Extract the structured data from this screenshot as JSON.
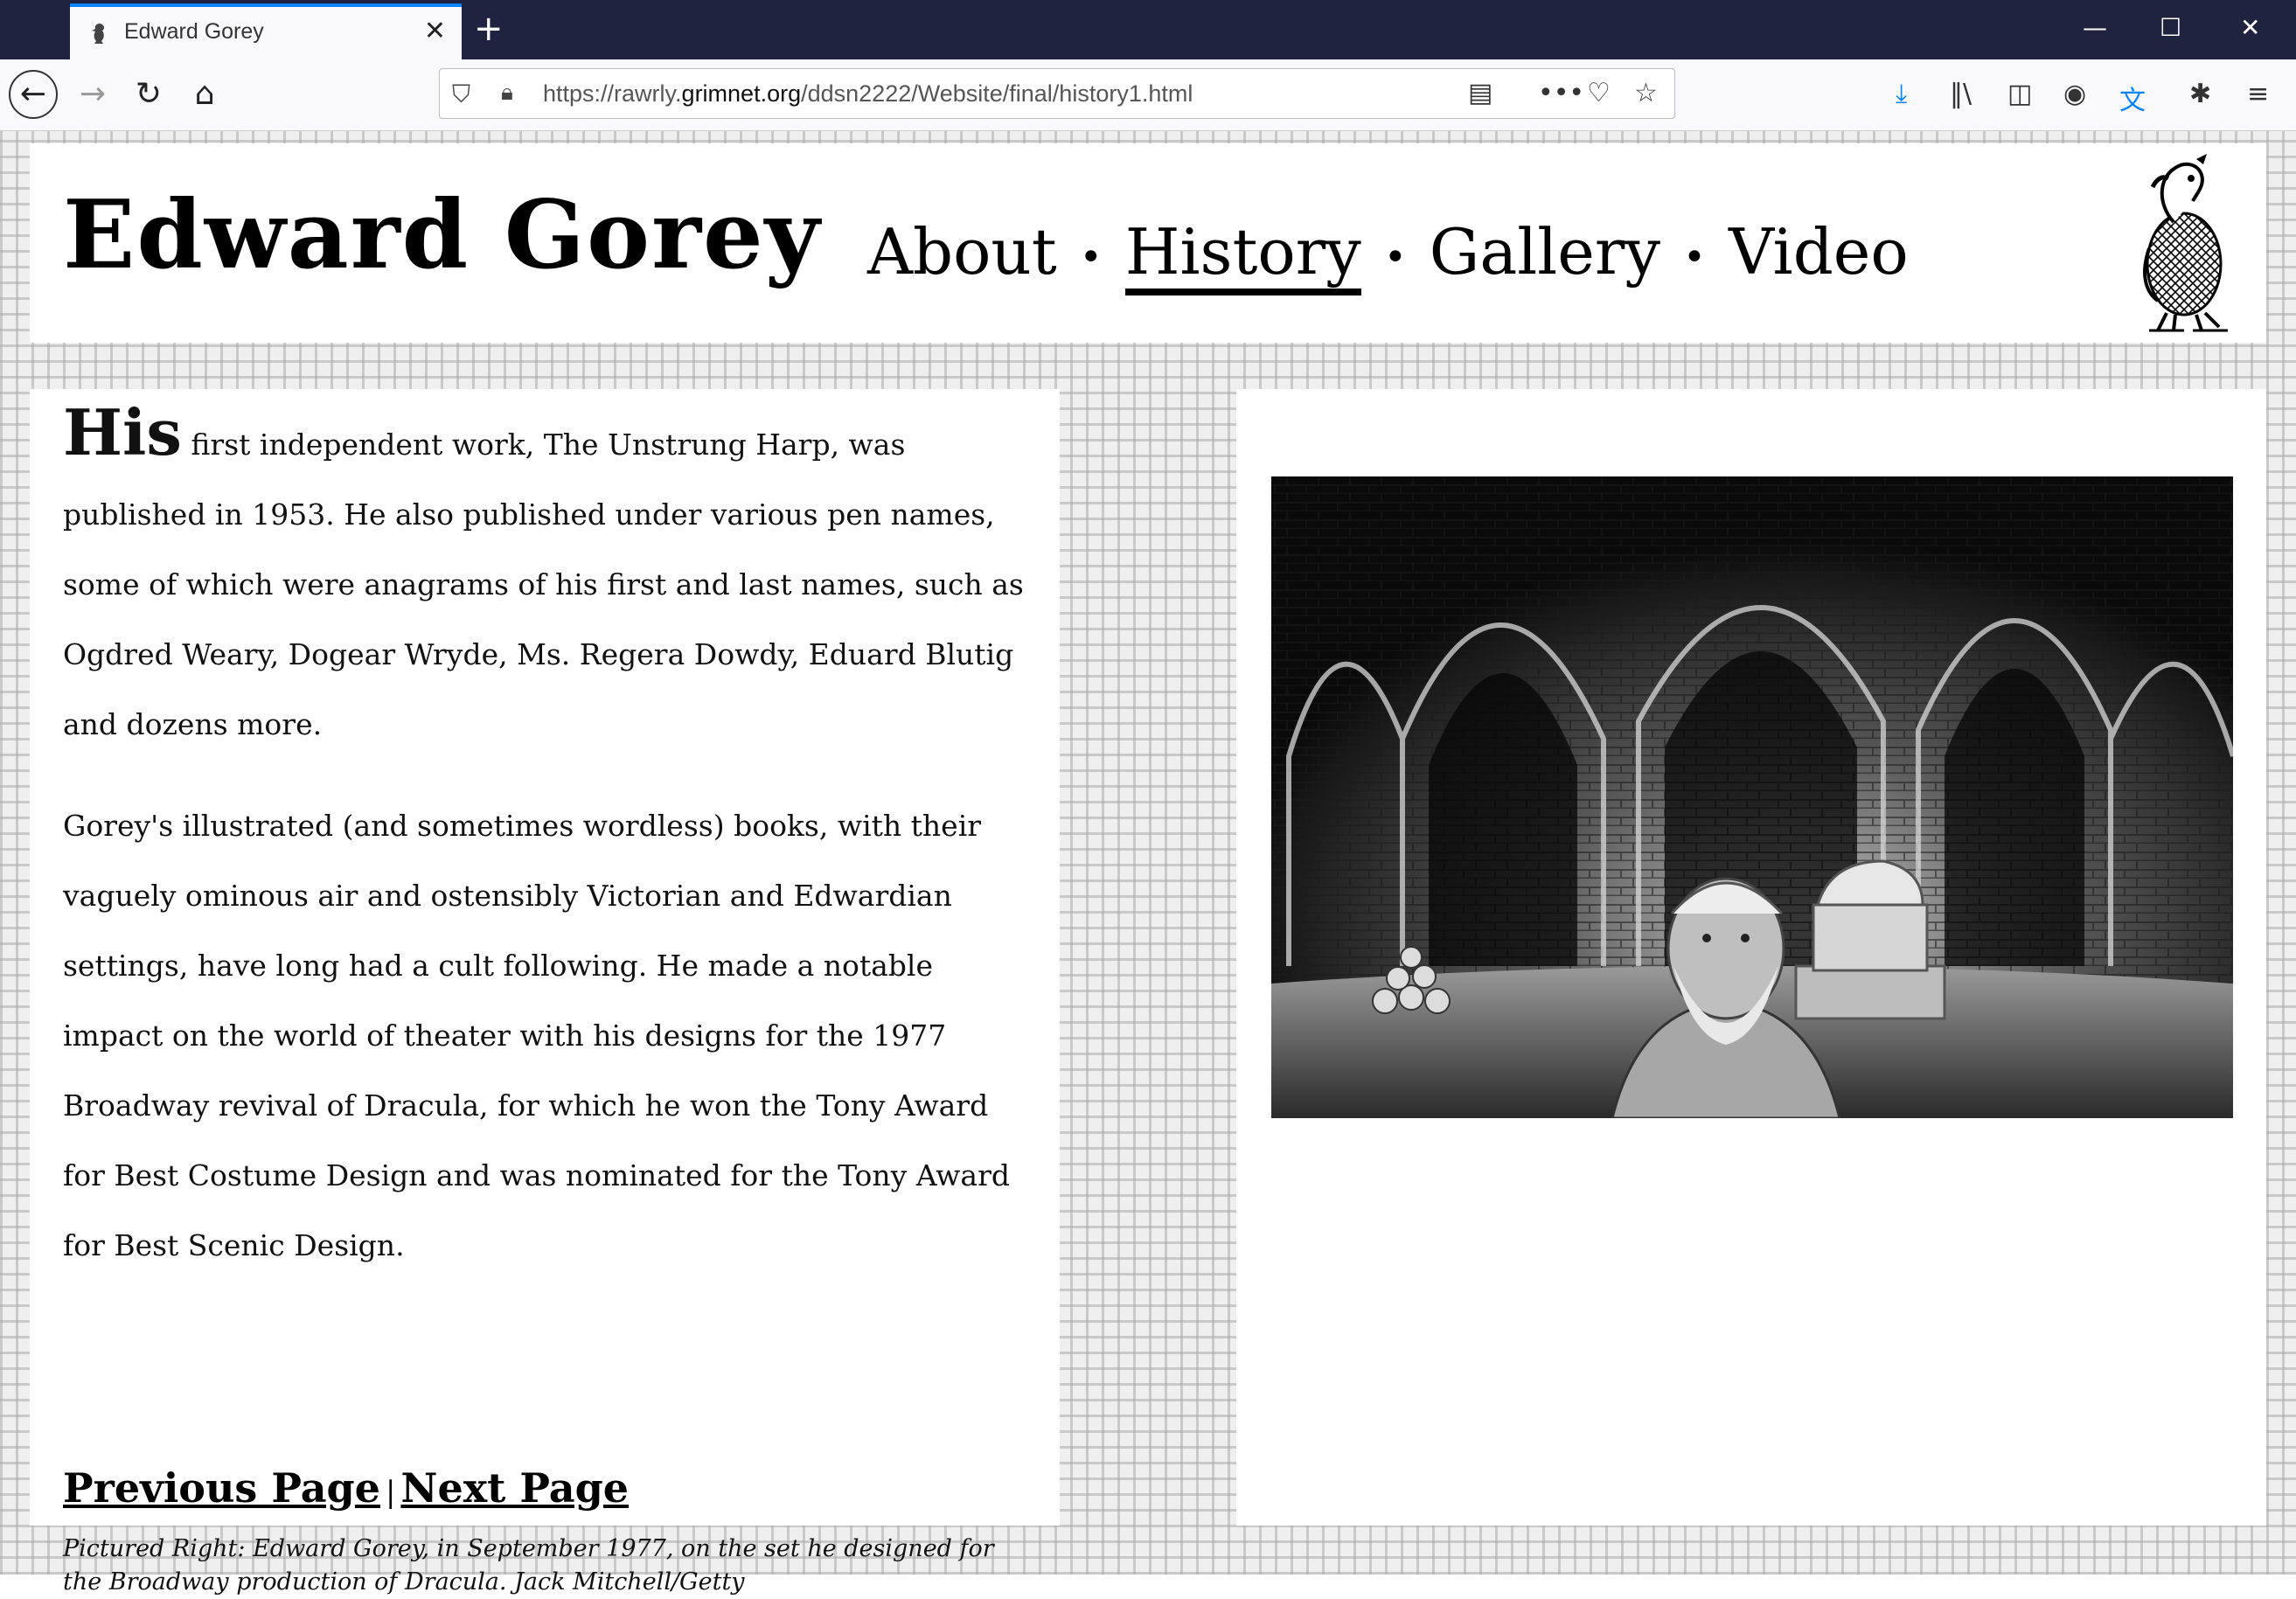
{
  "browser": {
    "tab_title": "Edward Gorey",
    "new_tab": "+",
    "tab_close": "✕",
    "url_prefix": "https://rawrly.",
    "url_domain": "grimnet.org",
    "url_path": "/ddsn2222/Website/final/history1.html",
    "window_controls": {
      "minimize": "—",
      "maximize": "☐",
      "close": "✕"
    },
    "icons": [
      "back-icon",
      "forward-icon",
      "reload-icon",
      "home-icon",
      "shield-icon",
      "lock-icon",
      "reader-view-icon",
      "more-actions-icon",
      "pocket-icon",
      "bookmark-star-icon",
      "download-icon",
      "library-icon",
      "sidebar-icon",
      "account-icon",
      "translate-icon",
      "extensions-icon",
      "menu-icon"
    ]
  },
  "header": {
    "site_title": "Edward Gorey",
    "nav": [
      {
        "label": "About"
      },
      {
        "label": "History",
        "current": true
      },
      {
        "label": "Gallery"
      },
      {
        "label": "Video"
      }
    ],
    "separator": "•"
  },
  "content": {
    "drop_word": "His",
    "paragraph1_rest": " first independent work, The Unstrung Harp, was published in 1953. He also published under various pen names, some of which were anagrams of his first and last names, such as Ogdred Weary, Dogear Wryde, Ms. Regera Dowdy, Eduard Blutig and dozens more.",
    "paragraph2": "Gorey's illustrated (and sometimes wordless) books, with their vaguely ominous air and ostensibly Victorian and Edwardian settings, have long had a cult following. He made a notable impact on the world of theater with his designs for the 1977 Broadway revival of Dracula, for which he won the Tony Award for Best Costume Design and was nominated for the Tony Award for Best Scenic Design.",
    "prev_link": "Previous Page",
    "pipe": "|",
    "next_link": "Next Page",
    "caption": "Pictured Right: Edward Gorey, in September 1977, on the set he designed for the Broadway production of Dracula. Jack Mitchell/Getty"
  },
  "colors": {
    "tabbar": "#202340",
    "tab_accent": "#0a84ff",
    "download_blue": "#0a84ff",
    "page_text": "#111111"
  }
}
